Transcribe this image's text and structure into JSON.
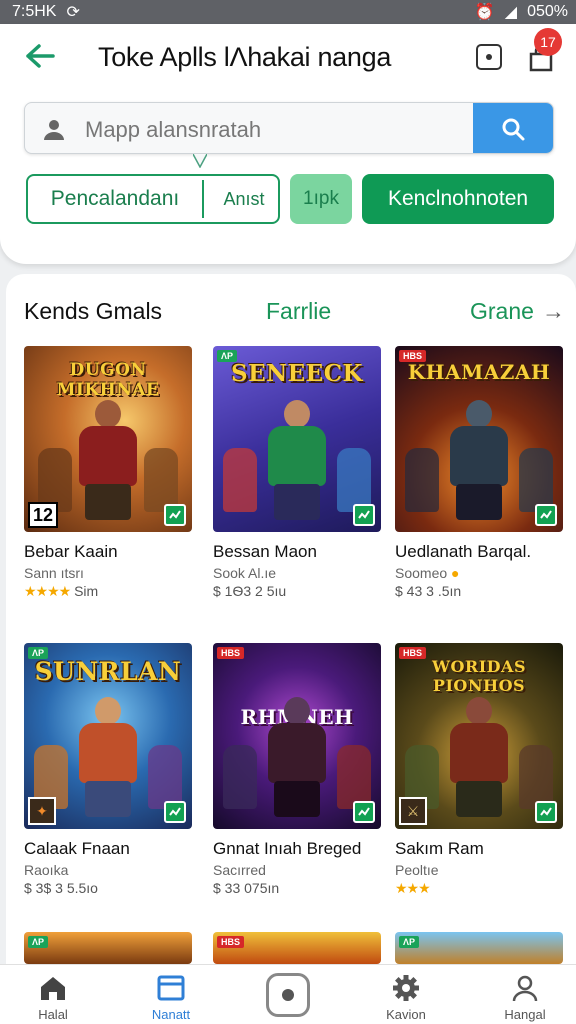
{
  "status": {
    "time": "7:5HK",
    "battery": "050%"
  },
  "header": {
    "title": "Toke Aplls lΛhakai  nanga",
    "badge_count": "17"
  },
  "search": {
    "placeholder": "Mapp alansnratah"
  },
  "filters": {
    "chip1": "Pencalandanı",
    "chip2": "Anıst",
    "chip3": "1ıpk",
    "chip4": "Kenclnohnoten"
  },
  "section": {
    "title": "Kends Gmals",
    "middle_link": "Farrlie",
    "right_link": "Grane",
    "arrow": "→"
  },
  "games": [
    {
      "art_title": "DUGON MIKHNAE",
      "name": "Bebar Kaain",
      "sub": "Sann ıtsrı",
      "meta": "Sim",
      "stars": "★★★★",
      "age": "12"
    },
    {
      "art_title": "SENEECK",
      "name": "Bessan Maon",
      "sub": "Sook Al.ıe",
      "meta": "$ 1Ѳ3 2 5ıu",
      "tag": "ΛP"
    },
    {
      "art_title": "KHAMAZAH",
      "name": "Uedlanath Barqal.",
      "sub": "Soomeo",
      "meta": "$ 43 3 .5ın",
      "tag": "HBS"
    },
    {
      "art_title": "SUNRLAN",
      "name": "Calaak Fnaan",
      "sub": "Raoıka",
      "meta": "$ 3$ 3 5.5ıo",
      "tag": "ΛP"
    },
    {
      "art_title": "RHMNEH",
      "name": "Gnnat Inıah Breged",
      "sub": "Sacırred",
      "meta": "$ 33 075ın",
      "tag": "HBS"
    },
    {
      "art_title": "WORIDAS PIONHOS",
      "name": "Sakım Ram",
      "sub": "Peoltıe",
      "meta": "",
      "stars": "★★★",
      "tag": "HBS"
    },
    {
      "art_title": "",
      "tag": "ΛP"
    },
    {
      "art_title": "",
      "tag": "HBS"
    },
    {
      "art_title": "",
      "tag": "ΛP"
    }
  ],
  "nav": [
    {
      "label": "Halal"
    },
    {
      "label": "Nanatt"
    },
    {
      "label": ""
    },
    {
      "label": "Kavion"
    },
    {
      "label": "Hangal"
    }
  ]
}
